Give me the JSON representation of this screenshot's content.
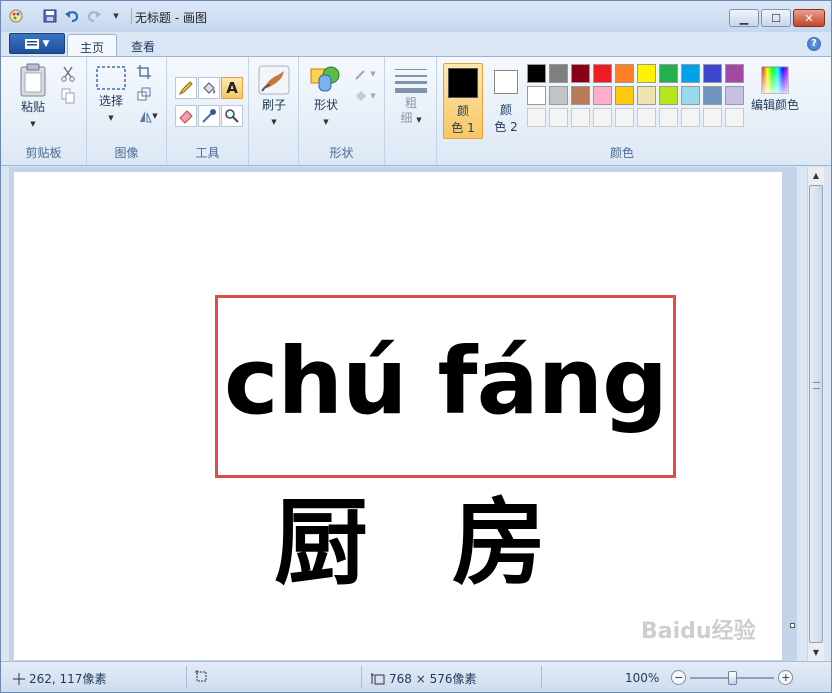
{
  "titlebar": {
    "title": "无标题 - 画图",
    "qat_icons": [
      "paint-app-icon",
      "save-icon",
      "undo-icon",
      "redo-icon",
      "qat-dropdown-icon"
    ],
    "window_buttons": [
      "minimize",
      "maximize",
      "close"
    ]
  },
  "tabs": {
    "home": "主页",
    "view": "查看"
  },
  "ribbon": {
    "clipboard": {
      "label": "剪贴板",
      "paste": "粘贴"
    },
    "image": {
      "label": "图像",
      "select": "选择"
    },
    "tools": {
      "label": "工具"
    },
    "brushes": {
      "label": "刷子"
    },
    "shapes": {
      "label": "形状",
      "shapes_button": "形状"
    },
    "size": {
      "line1": "粗",
      "line2": "细"
    },
    "colors": {
      "label": "颜色",
      "color1_line1": "颜",
      "color1_line2": "色 1",
      "color2_line1": "颜",
      "color2_line2": "色 2",
      "edit_colors": "编辑颜色",
      "color1_value": "#000000",
      "color2_value": "#ffffff",
      "palette_row1": [
        "#000000",
        "#7f7f7f",
        "#880015",
        "#ed1c24",
        "#ff7f27",
        "#fff200",
        "#22b14c",
        "#00a2e8",
        "#3f48cc",
        "#a349a4"
      ],
      "palette_row2": [
        "#ffffff",
        "#c3c3c3",
        "#b97a57",
        "#ffaec9",
        "#ffc90e",
        "#efe4b0",
        "#b5e61d",
        "#99d9ea",
        "#7092be",
        "#c8bfe7"
      ]
    }
  },
  "canvas": {
    "pinyin": "chú fáng",
    "hanzi": "厨房"
  },
  "status": {
    "cursor_pos": "262, 117像素",
    "image_size": "768 × 576像素",
    "zoom": "100%",
    "zoom_level": 1.0
  },
  "watermark": "Baidu经验"
}
